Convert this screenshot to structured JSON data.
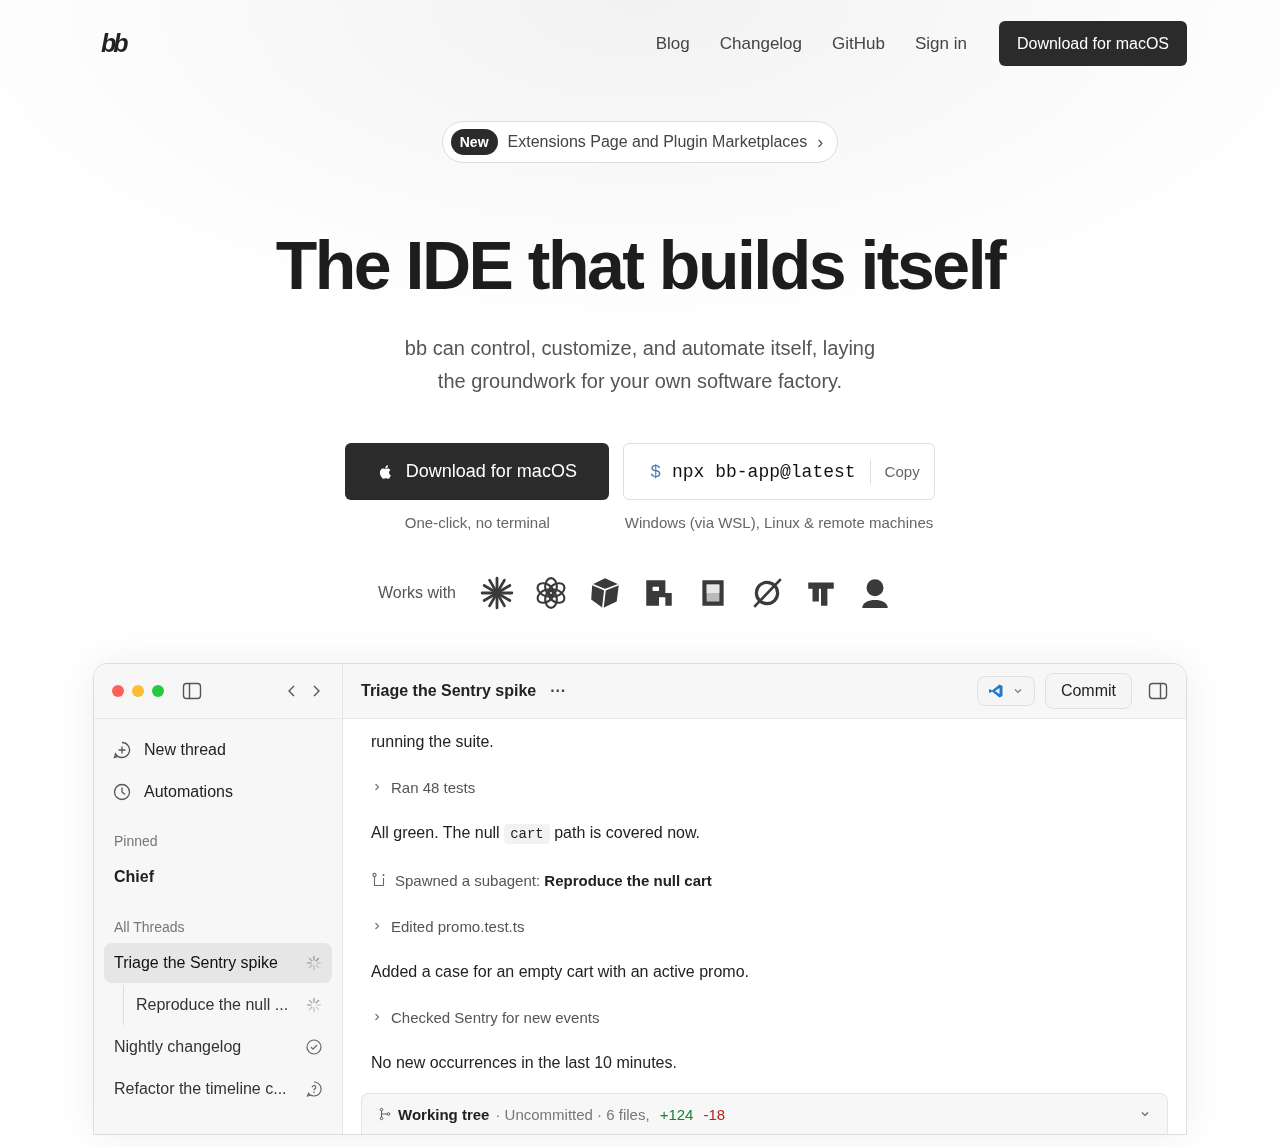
{
  "logo": {
    "text": "bb"
  },
  "nav": {
    "links": [
      {
        "label": "Blog"
      },
      {
        "label": "Changelog"
      },
      {
        "label": "GitHub"
      },
      {
        "label": "Sign in"
      }
    ],
    "cta": "Download for macOS"
  },
  "announcement": {
    "badge": "New",
    "text": "Extensions Page and Plugin Marketplaces",
    "arrow": "›"
  },
  "hero": {
    "title": "The IDE that builds itself",
    "subtitle_lines": [
      "bb can control, customize, and automate itself, laying",
      "the groundwork for your own software factory."
    ]
  },
  "install": {
    "download": {
      "label": "Download for macOS",
      "note": "One-click, no terminal"
    },
    "command": {
      "prompt": "$",
      "text": "npx bb-app@latest",
      "copy": "Copy",
      "note": "Windows (via WSL), Linux & remote machines"
    }
  },
  "works_with": {
    "label": "Works with",
    "logos": [
      {
        "kind": "sparkle"
      },
      {
        "kind": "knot"
      },
      {
        "kind": "cube"
      },
      {
        "kind": "pixel"
      },
      {
        "kind": "frame"
      },
      {
        "kind": "slash"
      },
      {
        "kind": "tee"
      },
      {
        "kind": "silhouette"
      }
    ]
  },
  "app": {
    "sidebar": {
      "actions": [
        {
          "kind": "new",
          "label": "New thread"
        },
        {
          "kind": "clock",
          "label": "Automations"
        }
      ],
      "sections": [
        {
          "title": "Pinned",
          "threads": [
            {
              "title": "Chief",
              "selected": false,
              "kind": "pinned"
            }
          ]
        },
        {
          "title": "All Threads",
          "threads": [
            {
              "title": "Triage the Sentry spike",
              "selected": true,
              "kind": "running",
              "children": [
                {
                  "title": "Reproduce the null ...",
                  "selected": false,
                  "kind": "running"
                }
              ]
            },
            {
              "title": "Nightly changelog",
              "selected": false,
              "kind": "done"
            },
            {
              "title": "Refactor the timeline c...",
              "selected": false,
              "kind": "question"
            }
          ]
        }
      ]
    },
    "header": {
      "title": "Triage the Sentry spike",
      "more": "···",
      "commit": "Commit"
    },
    "messages": [
      {
        "kind": "text",
        "segments": [
          {
            "kind": "plain",
            "text": "running the suite."
          }
        ]
      },
      {
        "kind": "step",
        "text": "Ran 48 tests"
      },
      {
        "kind": "text",
        "segments": [
          {
            "kind": "plain",
            "text": "All green. The null "
          },
          {
            "kind": "code",
            "text": "cart"
          },
          {
            "kind": "plain",
            "text": " path is covered now."
          }
        ]
      },
      {
        "kind": "spawn",
        "text": "Spawned a subagent: **Reproduce the null cart**"
      },
      {
        "kind": "step",
        "text": "Edited promo.test.ts"
      },
      {
        "kind": "text",
        "segments": [
          {
            "kind": "plain",
            "text": "Added a case for an empty cart with an active promo."
          }
        ]
      },
      {
        "kind": "step",
        "text": "Checked Sentry for new events"
      },
      {
        "kind": "text",
        "segments": [
          {
            "kind": "plain",
            "text": "No new occurrences in the last 10 minutes."
          }
        ]
      }
    ],
    "working_tree": {
      "title": "Working tree",
      "summary": "· Uncommitted · 6 files,",
      "added": "+124",
      "removed": "-18",
      "expanded": false
    }
  }
}
